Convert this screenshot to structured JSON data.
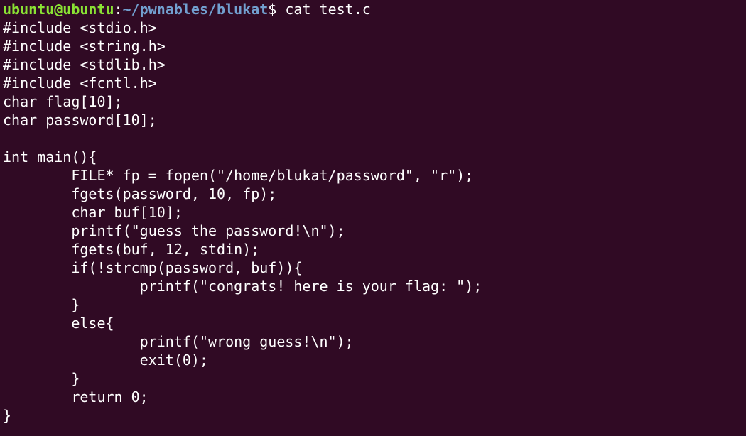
{
  "prompt": {
    "user_host": "ubuntu@ubuntu",
    "separator": ":",
    "path": "~/pwnables/blukat",
    "dollar": "$ ",
    "command": "cat test.c"
  },
  "colors": {
    "background": "#300a24",
    "user_host": "#8ae234",
    "path": "#729fcf",
    "text": "#ffffff"
  },
  "output_lines": [
    "#include <stdio.h>",
    "#include <string.h>",
    "#include <stdlib.h>",
    "#include <fcntl.h>",
    "char flag[10];",
    "char password[10];",
    "",
    "int main(){",
    "        FILE* fp = fopen(\"/home/blukat/password\", \"r\");",
    "        fgets(password, 10, fp);",
    "        char buf[10];",
    "        printf(\"guess the password!\\n\");",
    "        fgets(buf, 12, stdin);",
    "        if(!strcmp(password, buf)){",
    "                printf(\"congrats! here is your flag: \");",
    "        }",
    "        else{",
    "                printf(\"wrong guess!\\n\");",
    "                exit(0);",
    "        }",
    "        return 0;",
    "}"
  ]
}
